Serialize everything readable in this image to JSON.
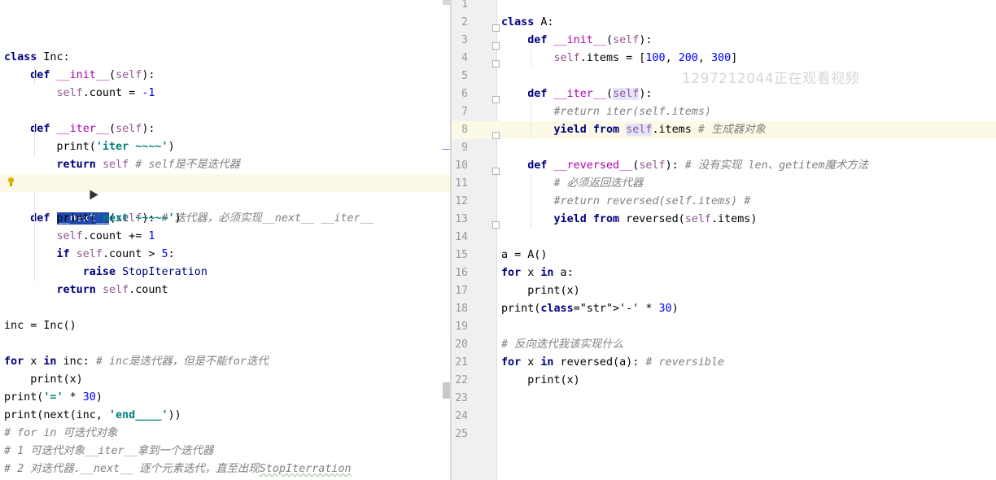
{
  "left": {
    "lines": [
      "class Inc:",
      "    def __init__(self):",
      "        self.count = -1",
      "",
      "    def __iter__(self):",
      "        print('iter ~~~~')",
      "        return self # self是不是迭代器",
      "",
      "    def __next__(self): # 迭代器，必须实现__next__ __iter__",
      "        print('next ~~~~~')",
      "        self.count += 1",
      "        if self.count > 5:",
      "            raise StopIteration",
      "        return self.count",
      "",
      "inc = Inc()",
      "",
      "for x in inc: # inc是迭代器，但是不能for迭代",
      "    print(x)",
      "print('=' * 30)",
      "print(next(inc, 'end____'))",
      "# for in 可迭代对象",
      "# 1 可迭代对象__iter__拿到一个迭代器",
      "# 2 对迭代器.__next__ 逐个元素迭代，直至出现StopIterration"
    ]
  },
  "right": {
    "line_numbers": [
      "1",
      "2",
      "3",
      "4",
      "5",
      "6",
      "7",
      "8",
      "9",
      "10",
      "11",
      "12",
      "13",
      "14",
      "15",
      "16",
      "17",
      "18",
      "19",
      "20",
      "21",
      "22",
      "23",
      "24",
      "25"
    ],
    "lines": [
      "",
      "class A:",
      "    def __init__(self):",
      "        self.items = [100, 200, 300]",
      "",
      "    def __iter__(self):",
      "        #return iter(self.items)",
      "        yield from self.items # 生成器对象",
      "",
      "    def __reversed__(self): # 没有实现 len、getitem魔术方法",
      "        # 必须返回迭代器",
      "        #return reversed(self.items) #",
      "        yield from reversed(self.items)",
      "",
      "a = A()",
      "for x in a:",
      "    print(x)",
      "print('-' * 30)",
      "",
      "# 反向迭代我该实现什么",
      "for x in reversed(a): # reversible",
      "    print(x)",
      "",
      "",
      ""
    ]
  },
  "watermark": "1297212044正在观看视频",
  "icons": {
    "lightbulb": "lightbulb-icon",
    "fold": "fold-marker-icon",
    "cursor": "mouse-cursor-icon"
  },
  "colors": {
    "keyword": "#000080",
    "self": "#94558d",
    "number": "#0000ff",
    "string": "#008080",
    "comment": "#808080",
    "dunder": "#b200b2",
    "current_line": "#fcfae6",
    "selection": "#2149b2"
  }
}
